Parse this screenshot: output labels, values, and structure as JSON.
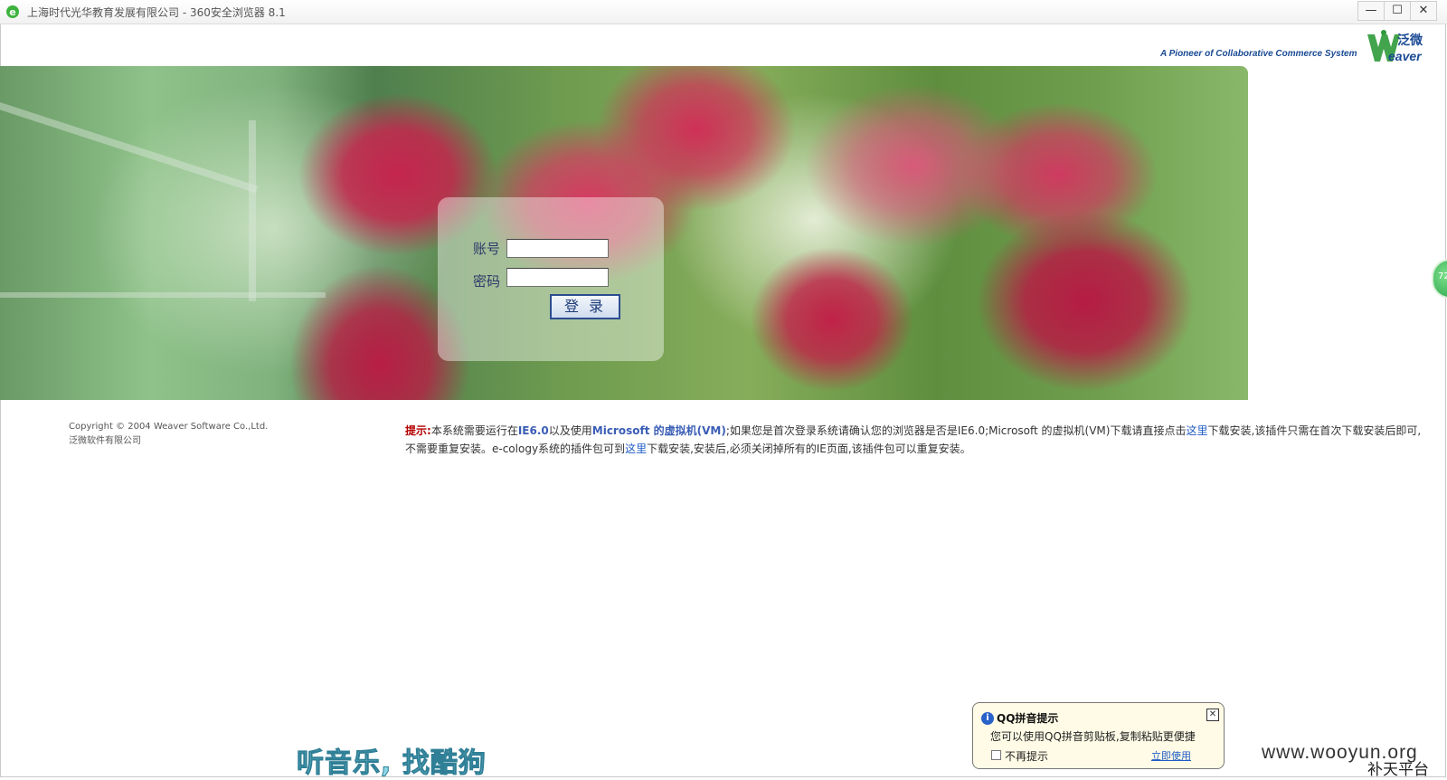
{
  "window": {
    "title": "上海时代光华教育发展有限公司 - 360安全浏览器 8.1",
    "controls": {
      "minimize": "—",
      "maximize": "☐",
      "close": "✕"
    }
  },
  "header": {
    "tagline": "A Pioneer of Collaborative Commerce System",
    "logo_cn": "泛微",
    "logo_en": "eaver"
  },
  "login": {
    "account_label": "账号",
    "password_label": "密码",
    "account_value": "",
    "password_value": "",
    "submit_label": "登 录"
  },
  "footer": {
    "copyright_line1": "Copyright © 2004 Weaver Software Co.,Ltd.",
    "copyright_line2": "泛微软件有限公司"
  },
  "notice": {
    "tip_label": "提示:",
    "part1": "本系统需要运行在",
    "ie": "IE6.0",
    "part2": "以及使用",
    "vm": "Microsoft 的虚拟机(VM)",
    "part3": ";如果您是首次登录系统请确认您的浏览器是否是IE6.0;Microsoft 的虚拟机(VM)下载请直接点击",
    "link1": "这里",
    "part4": "下载安装,该插件只需在首次下载安装后即可,不需要重复安装。e-cology系统的插件包可到",
    "link2": "这里",
    "part5": "下载安装,安装后,必须关闭掉所有的IE页面,该插件包可以重复安装。"
  },
  "side_widget": {
    "text": "72"
  },
  "ad": {
    "text": "听音乐, 找酷狗"
  },
  "watermark": {
    "text": "www.wooyun.org",
    "sub": "补天平台"
  },
  "qq_popup": {
    "title": "QQ拼音提示",
    "message": "您可以使用QQ拼音剪贴板,复制粘贴更便捷",
    "checkbox_label": "不再提示",
    "link": "立即使用",
    "close": "✕"
  },
  "colors": {
    "tip_red": "#b40000",
    "link_blue": "#1f5cc7",
    "brand_blue": "#1a4a93",
    "brand_green": "#2e9a3a"
  },
  "icons": [
    "ie-icon",
    "minimize-icon",
    "maximize-icon",
    "close-icon",
    "weaver-logo",
    "info-icon"
  ]
}
